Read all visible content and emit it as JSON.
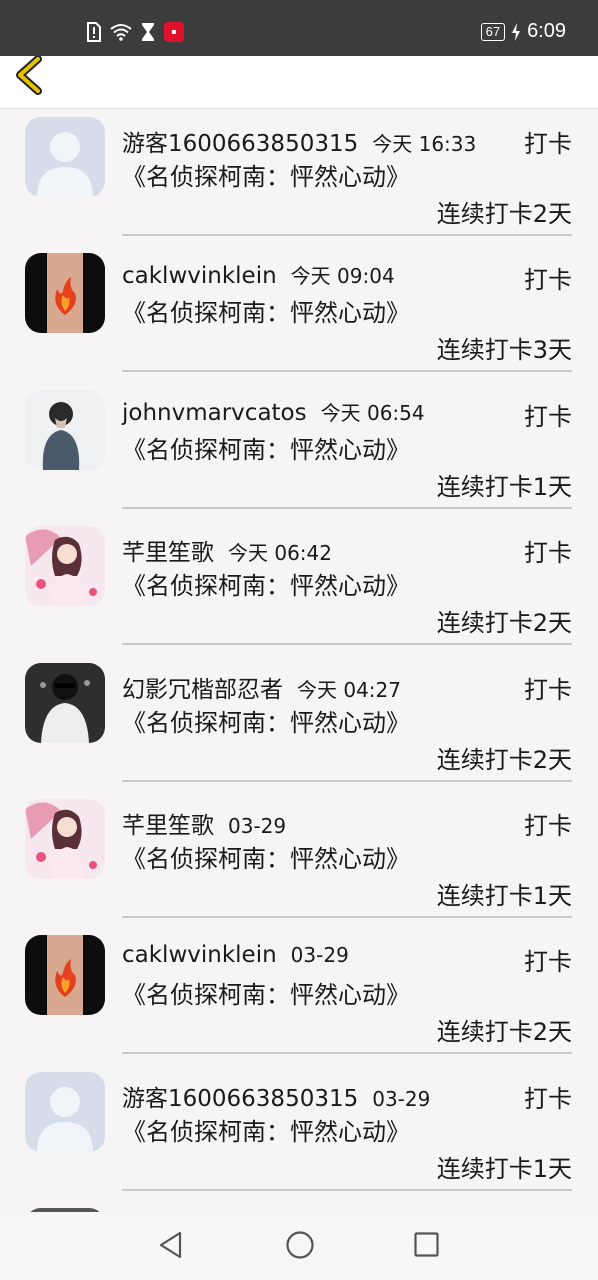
{
  "status_bar": {
    "time": "6:09",
    "battery": "67",
    "icons": [
      "alert-icon",
      "wifi-icon",
      "hourglass-icon",
      "app-notification-icon"
    ]
  },
  "header": {
    "back_icon": "chevron-left-icon"
  },
  "entries": [
    {
      "user": "游客1600663850315",
      "time": "今天 16:33",
      "action": "打卡",
      "book": "《名侦探柯南：怦然心动》",
      "streak": "连续打卡2天",
      "avatar": "default-avatar"
    },
    {
      "user": "caklwvinklein",
      "time": "今天 09:04",
      "action": "打卡",
      "book": "《名侦探柯南：怦然心动》",
      "streak": "连续打卡3天",
      "avatar": "flame-tattoo-avatar"
    },
    {
      "user": "johnvmarvcatos",
      "time": "今天 06:54",
      "action": "打卡",
      "book": "《名侦探柯南：怦然心动》",
      "streak": "连续打卡1天",
      "avatar": "person-photo-avatar"
    },
    {
      "user": "芊里笙歌",
      "time": "今天 06:42",
      "action": "打卡",
      "book": "《名侦探柯南：怦然心动》",
      "streak": "连续打卡2天",
      "avatar": "anime-girl-avatar"
    },
    {
      "user": "幻影冗楷部忍者",
      "time": "今天 04:27",
      "action": "打卡",
      "book": "《名侦探柯南：怦然心动》",
      "streak": "连续打卡2天",
      "avatar": "dark-photo-avatar"
    },
    {
      "user": "芊里笙歌",
      "time": "03-29",
      "action": "打卡",
      "book": "《名侦探柯南：怦然心动》",
      "streak": "连续打卡1天",
      "avatar": "anime-girl-avatar"
    },
    {
      "user": "caklwvinklein",
      "time": "03-29",
      "action": "打卡",
      "book": "《名侦探柯南：怦然心动》",
      "streak": "连续打卡2天",
      "avatar": "flame-tattoo-avatar"
    },
    {
      "user": "游客1600663850315",
      "time": "03-29",
      "action": "打卡",
      "book": "《名侦探柯南：怦然心动》",
      "streak": "连续打卡1天",
      "avatar": "default-avatar"
    }
  ],
  "nav_bar": {
    "buttons": [
      "back-triangle-icon",
      "home-circle-icon",
      "recents-square-icon"
    ]
  },
  "colors": {
    "status_bar": "#3c3c3c",
    "background": "#f6f4f5",
    "back_arrow": "#e6c300",
    "divider": "#c9c9c9"
  }
}
